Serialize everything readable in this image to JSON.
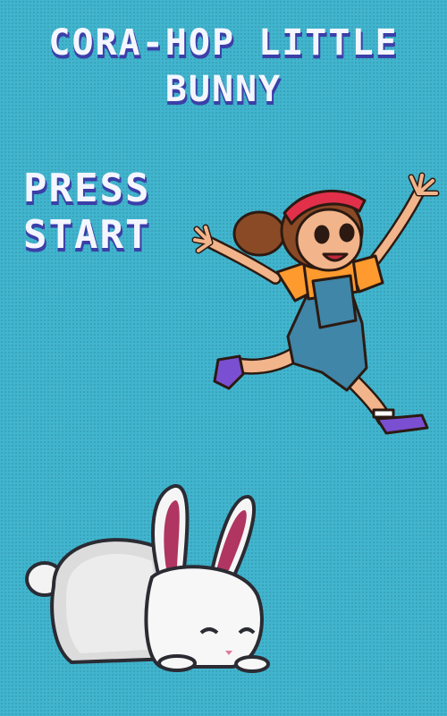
{
  "game": {
    "title_line1": "CORA-HOP LITTLE",
    "title_line2": "BUNNY",
    "prompt_line1": "PRESS",
    "prompt_line2": "START"
  },
  "colors": {
    "background": "#41b5cf",
    "text": "#f4f6ff",
    "text_shadow": "#3b3fa8"
  },
  "sprites": {
    "girl": "jumping-girl-sprite",
    "bunny": "sleeping-bunny-sprite"
  }
}
